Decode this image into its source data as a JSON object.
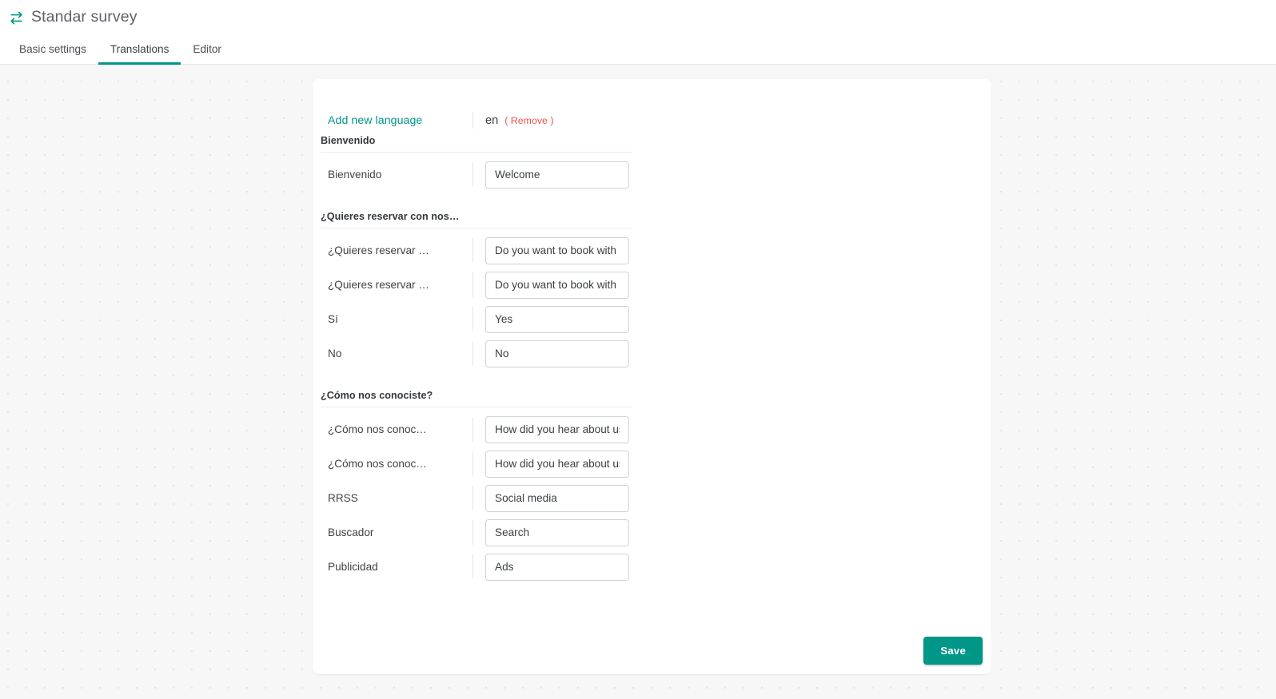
{
  "header": {
    "icon": "swap-horizontal-icon",
    "title": "Standar survey",
    "tabs": [
      {
        "label": "Basic settings",
        "active": false
      },
      {
        "label": "Translations",
        "active": true
      },
      {
        "label": "Editor",
        "active": false
      }
    ]
  },
  "colors": {
    "accent": "#009688",
    "danger": "#ef5350",
    "page_background": "#f7f7f8",
    "card_background": "#ffffff",
    "border": "#cfd3d6",
    "text": "#3c4043"
  },
  "language_bar": {
    "add_language_label": "Add new language",
    "current_language": "en",
    "remove_label": "( Remove )"
  },
  "sections": [
    {
      "title": "Bienvenido",
      "rows": [
        {
          "label": "Bienvenido",
          "value": "Welcome",
          "placeholder": ""
        }
      ]
    },
    {
      "title": "¿Quieres reservar con nos…",
      "rows": [
        {
          "label": "¿Quieres reservar …",
          "value": "Do you want to book with us?",
          "placeholder": ""
        },
        {
          "label": "¿Quieres reservar …",
          "value": "Do you want to book with us?",
          "placeholder": ""
        },
        {
          "label": "Sí",
          "value": "Yes",
          "placeholder": ""
        },
        {
          "label": "No",
          "value": "No",
          "placeholder": ""
        }
      ]
    },
    {
      "title": "¿Cómo nos conociste?",
      "rows": [
        {
          "label": "¿Cómo nos conoc…",
          "value": "How did you hear about us?",
          "placeholder": ""
        },
        {
          "label": "¿Cómo nos conoc…",
          "value": "How did you hear about us?",
          "placeholder": ""
        },
        {
          "label": "RRSS",
          "value": "Social media",
          "placeholder": ""
        },
        {
          "label": "Buscador",
          "value": "Search",
          "placeholder": ""
        },
        {
          "label": "Publicidad",
          "value": "Ads",
          "placeholder": ""
        }
      ]
    }
  ],
  "footer": {
    "save_label": "Save"
  }
}
